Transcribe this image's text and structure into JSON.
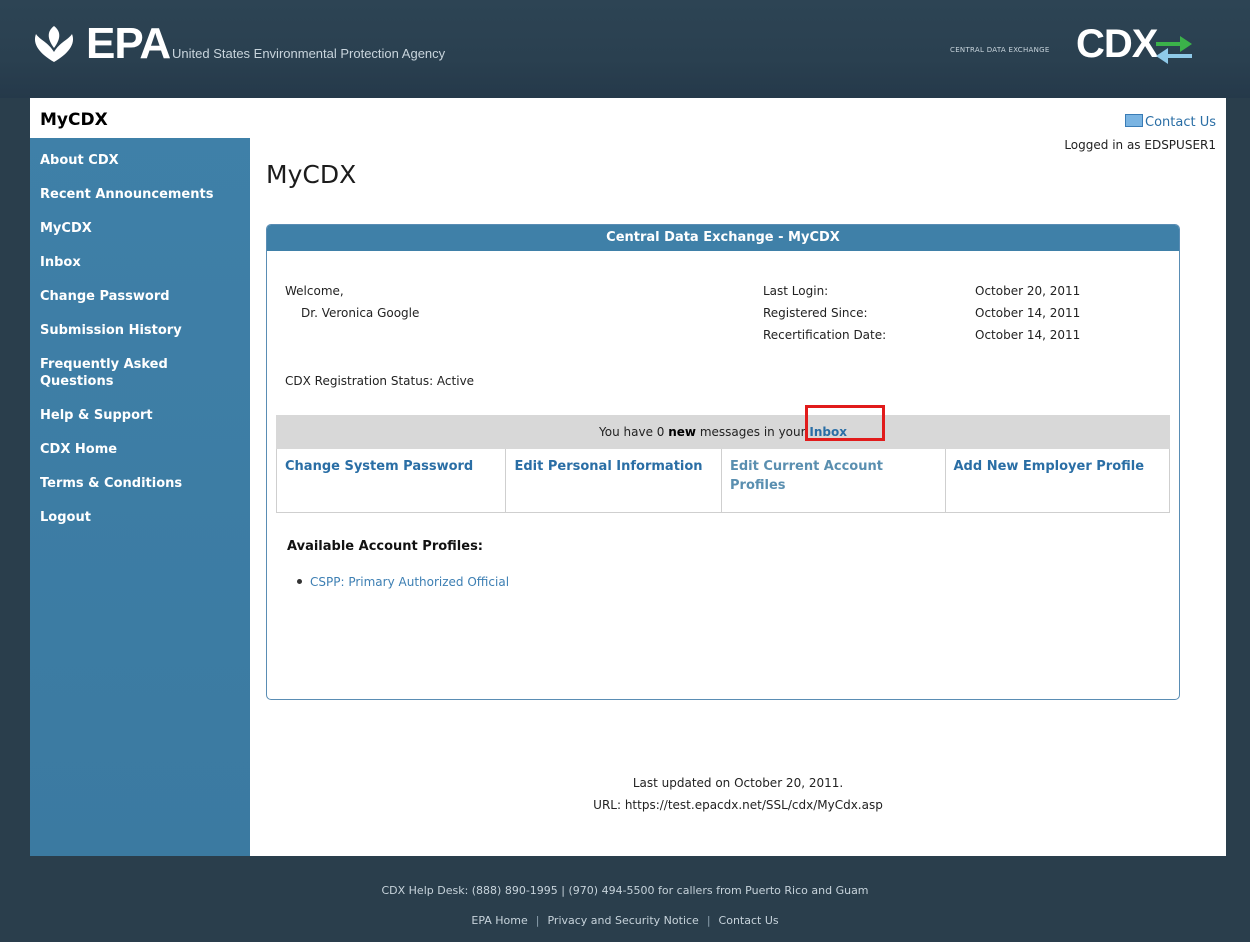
{
  "header": {
    "epa_wordmark": "EPA",
    "agency_name": "United States Environmental Protection Agency",
    "cdx_small_text": "CENTRAL DATA EXCHANGE",
    "cdx_wordmark": "CDX"
  },
  "sidebar": {
    "title": "MyCDX",
    "items": [
      {
        "label": "About CDX"
      },
      {
        "label": "Recent Announcements"
      },
      {
        "label": "MyCDX"
      },
      {
        "label": "Inbox"
      },
      {
        "label": "Change Password"
      },
      {
        "label": "Submission History"
      },
      {
        "label": "Frequently Asked Questions"
      },
      {
        "label": "Help & Support"
      },
      {
        "label": "CDX Home"
      },
      {
        "label": "Terms & Conditions"
      },
      {
        "label": "Logout"
      }
    ]
  },
  "top_right": {
    "contact_us": "Contact Us",
    "logged_in": "Logged in as EDSPUSER1"
  },
  "page": {
    "title": "MyCDX"
  },
  "panel": {
    "title": "Central Data Exchange - MyCDX",
    "welcome_label": "Welcome,",
    "user_name": "Dr. Veronica Google",
    "info": [
      {
        "key": "Last Login:",
        "value": "October 20, 2011"
      },
      {
        "key": "Registered Since:",
        "value": "October 14, 2011"
      },
      {
        "key": "Recertification Date:",
        "value": "October 14, 2011"
      }
    ],
    "status_text": "CDX Registration Status: Active",
    "message_prefix": "You have 0 ",
    "message_bold": "new",
    "message_suffix": " messages in your ",
    "message_link": "Inbox",
    "actions": [
      {
        "label": "Change System Password"
      },
      {
        "label": "Edit Personal Information"
      },
      {
        "label": "Edit Current Account Profiles"
      },
      {
        "label": "Add New Employer Profile"
      }
    ],
    "profiles_title": "Available Account Profiles:",
    "profiles": [
      {
        "label": "CSPP: Primary Authorized Official"
      }
    ]
  },
  "page_footer": {
    "updated": "Last updated on October 20, 2011.",
    "url": "URL: https://test.epacdx.net/SSL/cdx/MyCdx.asp"
  },
  "footer": {
    "helpdesk": "CDX Help Desk: (888) 890-1995 | (970) 494-5500 for callers from Puerto Rico and Guam",
    "links": [
      {
        "label": "EPA Home"
      },
      {
        "label": "Privacy and Security Notice"
      },
      {
        "label": "Contact Us"
      }
    ]
  },
  "colors": {
    "banner": "#2a4050",
    "sidebar": "#3f80a8",
    "link": "#2a6ea5",
    "highlight": "#e11b1b"
  }
}
